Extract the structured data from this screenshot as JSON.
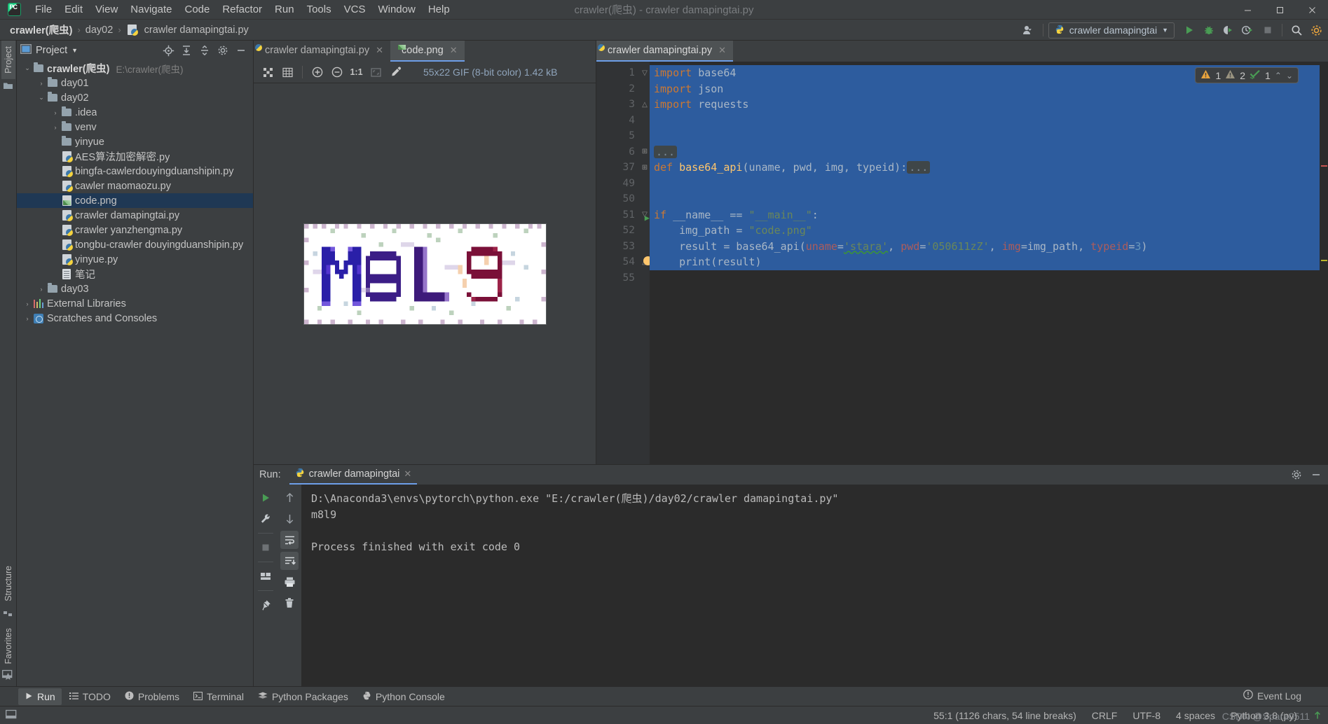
{
  "window": {
    "title": "crawler(爬虫) - crawler damapingtai.py",
    "minimize": "—",
    "maximize": "▭",
    "close": "✕",
    "app_logo": "pycharm-logo"
  },
  "menubar": {
    "items": [
      {
        "label": "File"
      },
      {
        "label": "Edit"
      },
      {
        "label": "View"
      },
      {
        "label": "Navigate"
      },
      {
        "label": "Code"
      },
      {
        "label": "Refactor"
      },
      {
        "label": "Run"
      },
      {
        "label": "Tools"
      },
      {
        "label": "VCS"
      },
      {
        "label": "Window"
      },
      {
        "label": "Help"
      }
    ]
  },
  "breadcrumb": {
    "items": [
      "crawler(爬虫)",
      "day02",
      "crawler damapingtai.py"
    ],
    "separator": "›"
  },
  "toolbar": {
    "run_config": "crawler damapingtai",
    "icons": [
      "user-icon",
      "run-icon",
      "debug-icon",
      "coverage-icon",
      "profile-icon",
      "stop-icon",
      "search-icon",
      "settings-icon"
    ]
  },
  "project_panel": {
    "title": "Project",
    "header_icons": [
      "locate-icon",
      "expand-all-icon",
      "collapse-all-icon",
      "settings-icon",
      "hide-icon"
    ],
    "tree": [
      {
        "depth": 0,
        "arrow": "down",
        "icon": "folder",
        "label": "crawler(爬虫)",
        "bold": true,
        "path": "E:\\crawler(爬虫)"
      },
      {
        "depth": 1,
        "arrow": "right",
        "icon": "folder",
        "label": "day01"
      },
      {
        "depth": 1,
        "arrow": "down",
        "icon": "folder",
        "label": "day02"
      },
      {
        "depth": 2,
        "arrow": "right",
        "icon": "folder",
        "label": ".idea"
      },
      {
        "depth": 2,
        "arrow": "right",
        "icon": "folder",
        "label": "venv"
      },
      {
        "depth": 2,
        "arrow": "none",
        "icon": "folder",
        "label": "yinyue"
      },
      {
        "depth": 2,
        "arrow": "none",
        "icon": "python",
        "label": "AES算法加密解密.py"
      },
      {
        "depth": 2,
        "arrow": "none",
        "icon": "python",
        "label": "bingfa-cawlerdouyingduanshipin.py"
      },
      {
        "depth": 2,
        "arrow": "none",
        "icon": "python",
        "label": "cawler maomaozu.py"
      },
      {
        "depth": 2,
        "arrow": "none",
        "icon": "image",
        "label": "code.png",
        "selected": true
      },
      {
        "depth": 2,
        "arrow": "none",
        "icon": "python",
        "label": "crawler damapingtai.py"
      },
      {
        "depth": 2,
        "arrow": "none",
        "icon": "python",
        "label": "crawler yanzhengma.py"
      },
      {
        "depth": 2,
        "arrow": "none",
        "icon": "python",
        "label": "tongbu-crawler douyingduanshipin.py"
      },
      {
        "depth": 2,
        "arrow": "none",
        "icon": "python",
        "label": "yinyue.py"
      },
      {
        "depth": 2,
        "arrow": "none",
        "icon": "text",
        "label": "笔记"
      },
      {
        "depth": 1,
        "arrow": "right",
        "icon": "folder",
        "label": "day03"
      },
      {
        "depth": 0,
        "arrow": "right",
        "icon": "libraries",
        "label": "External Libraries"
      },
      {
        "depth": 0,
        "arrow": "right",
        "icon": "scratches",
        "label": "Scratches and Consoles"
      }
    ]
  },
  "left_strip": {
    "tabs": [
      "Project",
      "Structure",
      "Favorites"
    ]
  },
  "image_pane": {
    "tabs": [
      {
        "label": "crawler damapingtai.py",
        "icon": "python",
        "active": false
      },
      {
        "label": "code.png",
        "icon": "image",
        "active": true
      }
    ],
    "toolbar": {
      "buttons": [
        "transparency-grid-icon",
        "grid-icon",
        "zoom-in-icon",
        "zoom-out-icon",
        "actual-size-icon",
        "fit-icon",
        "color-picker-icon"
      ],
      "actual_size_label": "1:1",
      "info": "55x22 GIF (8-bit color) 1.42 kB"
    },
    "captcha_text": "M8L9"
  },
  "code_pane": {
    "tabs": [
      {
        "label": "crawler damapingtai.py",
        "icon": "python",
        "active": true
      }
    ],
    "inspection": {
      "warning_count": "1",
      "weak_warning_count": "2",
      "typo_count": "1",
      "up_arrow": "⌃",
      "down_arrow": "⌄"
    },
    "lines": [
      {
        "num": "1",
        "fold": "▽",
        "selected": true,
        "tokens": [
          {
            "t": "import ",
            "c": "kw"
          },
          {
            "t": "base64",
            "c": ""
          }
        ]
      },
      {
        "num": "2",
        "fold": "",
        "selected": true,
        "tokens": [
          {
            "t": "import ",
            "c": "kw"
          },
          {
            "t": "json",
            "c": ""
          }
        ]
      },
      {
        "num": "3",
        "fold": "△",
        "selected": true,
        "tokens": [
          {
            "t": "import ",
            "c": "kw"
          },
          {
            "t": "requests",
            "c": ""
          }
        ]
      },
      {
        "num": "4",
        "fold": "",
        "selected": true,
        "tokens": []
      },
      {
        "num": "5",
        "fold": "",
        "selected": true,
        "tokens": []
      },
      {
        "num": "6",
        "fold": "⊞",
        "selected": true,
        "tokens": [
          {
            "t": "...",
            "c": "dots"
          }
        ]
      },
      {
        "num": "37",
        "fold": "⊞",
        "selected": true,
        "tokens": [
          {
            "t": "def ",
            "c": "kw"
          },
          {
            "t": "base64_api",
            "c": "fn"
          },
          {
            "t": "(uname, pwd, img, typeid):",
            "c": ""
          },
          {
            "t": "...",
            "c": "dots"
          }
        ]
      },
      {
        "num": "49",
        "fold": "",
        "selected": true,
        "tokens": []
      },
      {
        "num": "50",
        "fold": "",
        "selected": true,
        "tokens": []
      },
      {
        "num": "51",
        "fold": "▽",
        "selected": true,
        "runmark": true,
        "tokens": [
          {
            "t": "if ",
            "c": "kw"
          },
          {
            "t": "__name__ == ",
            "c": ""
          },
          {
            "t": "\"__main__\"",
            "c": "str"
          },
          {
            "t": ":",
            "c": ""
          }
        ]
      },
      {
        "num": "52",
        "fold": "",
        "selected": true,
        "tokens": [
          {
            "t": "    img_path = ",
            "c": ""
          },
          {
            "t": "\"code.png\"",
            "c": "str"
          }
        ]
      },
      {
        "num": "53",
        "fold": "",
        "selected": true,
        "tokens": [
          {
            "t": "    result = base64_api(",
            "c": ""
          },
          {
            "t": "uname",
            "c": "param"
          },
          {
            "t": "=",
            "c": ""
          },
          {
            "t": "'stara'",
            "c": "str squig"
          },
          {
            "t": ", ",
            "c": ""
          },
          {
            "t": "pwd",
            "c": "param"
          },
          {
            "t": "=",
            "c": ""
          },
          {
            "t": "'050611zZ'",
            "c": "str"
          },
          {
            "t": ", ",
            "c": ""
          },
          {
            "t": "img",
            "c": "param"
          },
          {
            "t": "=img_path, ",
            "c": ""
          },
          {
            "t": "typeid",
            "c": "param"
          },
          {
            "t": "=",
            "c": ""
          },
          {
            "t": "3",
            "c": "num"
          },
          {
            "t": ")",
            "c": ""
          }
        ]
      },
      {
        "num": "54",
        "fold": "△",
        "selected": true,
        "bulb": true,
        "tokens": [
          {
            "t": "    print(result)",
            "c": ""
          }
        ]
      },
      {
        "num": "55",
        "fold": "",
        "selected": false,
        "tokens": []
      }
    ]
  },
  "run_panel": {
    "label": "Run:",
    "tab": "crawler damapingtai",
    "tab_icon": "python",
    "header_icons": [
      "settings-icon",
      "hide-icon"
    ],
    "toolbar_left": [
      "rerun-icon",
      "wrench-icon",
      "stop-icon",
      "layout-icon",
      "pin-icon"
    ],
    "toolbar_right": [
      "up-icon",
      "down-icon",
      "soft-wrap-icon",
      "scroll-to-end-icon",
      "print-icon",
      "trash-icon"
    ],
    "console": [
      "D:\\Anaconda3\\envs\\pytorch\\python.exe \"E:/crawler(爬虫)/day02/crawler damapingtai.py\"",
      "m8l9",
      "",
      "Process finished with exit code 0"
    ]
  },
  "toolwindow_bar": {
    "items": [
      {
        "label": "Run",
        "icon": "run-icon",
        "active": true
      },
      {
        "label": "TODO",
        "icon": "todo-icon",
        "active": false
      },
      {
        "label": "Problems",
        "icon": "problems-icon",
        "active": false
      },
      {
        "label": "Terminal",
        "icon": "terminal-icon",
        "active": false
      },
      {
        "label": "Python Packages",
        "icon": "packages-icon",
        "active": false
      },
      {
        "label": "Python Console",
        "icon": "python-icon",
        "active": false
      }
    ]
  },
  "statusbar": {
    "caret": "55:1 (1126 chars, 54 line breaks)",
    "line_sep": "CRLF",
    "encoding": "UTF-8",
    "indent": "4 spaces",
    "interpreter": "Python 3.8 (py)",
    "event_log": "Event Log",
    "watermark": "CSDN @Spara0511"
  },
  "colors": {
    "accent": "#4b6eaf",
    "selection": "#2d5c9e",
    "tree_selection": "#1f3854",
    "keyword": "#cc7832",
    "string": "#6a8759",
    "function": "#ffc66d",
    "param": "#ad5c5c",
    "number": "#6897bb",
    "run_green": "#499c54",
    "panel_bg": "#3c3f41",
    "editor_bg": "#2b2b2b"
  }
}
